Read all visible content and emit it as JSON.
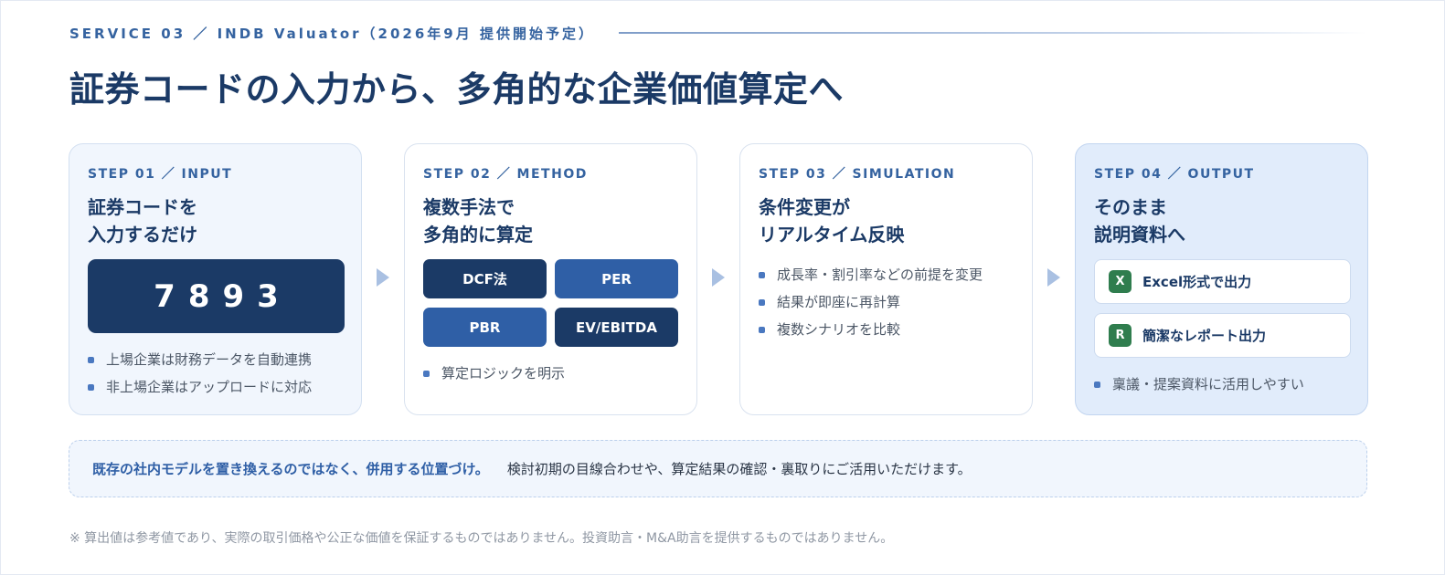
{
  "header": {
    "kicker": "SERVICE 03 ／ INDB Valuator（2026年9月 提供開始予定）",
    "title": "証券コードの入力から、多角的な企業価値算定へ"
  },
  "steps": [
    {
      "label": "STEP 01 ／ INPUT",
      "title_line1": "証券コードを",
      "title_line2": "入力するだけ",
      "code": "7893",
      "bullets": [
        "上場企業は財務データを自動連携",
        "非上場企業はアップロードに対応"
      ]
    },
    {
      "label": "STEP 02 ／ METHOD",
      "title_line1": "複数手法で",
      "title_line2": "多角的に算定",
      "methods": [
        "DCF法",
        "PER",
        "PBR",
        "EV/EBITDA"
      ],
      "bullets": [
        "算定ロジックを明示"
      ]
    },
    {
      "label": "STEP 03 ／ SIMULATION",
      "title_line1": "条件変更が",
      "title_line2": "リアルタイム反映",
      "bullets": [
        "成長率・割引率などの前提を変更",
        "結果が即座に再計算",
        "複数シナリオを比較"
      ]
    },
    {
      "label": "STEP 04 ／ OUTPUT",
      "title_line1": "そのまま",
      "title_line2": "説明資料へ",
      "outputs": [
        {
          "icon": "X",
          "label": "Excel形式で出力"
        },
        {
          "icon": "R",
          "label": "簡潔なレポート出力"
        }
      ],
      "bullets": [
        "稟議・提案資料に活用しやすい"
      ]
    }
  ],
  "note": {
    "strong": "既存の社内モデルを置き換えるのではなく、併用する位置づけ。",
    "text": "検討初期の目線合わせや、算定結果の確認・裏取りにご活用いただけます。"
  },
  "disclaimer": "※ 算出値は参考値であり、実際の取引価格や公正な価値を保証するものではありません。投資助言・M&A助言を提供するものではありません。",
  "colors": {
    "navy": "#1b3a66",
    "blue": "#2f5fa6",
    "accent": "#3563a0",
    "excel_green": "#2f7d4e"
  }
}
